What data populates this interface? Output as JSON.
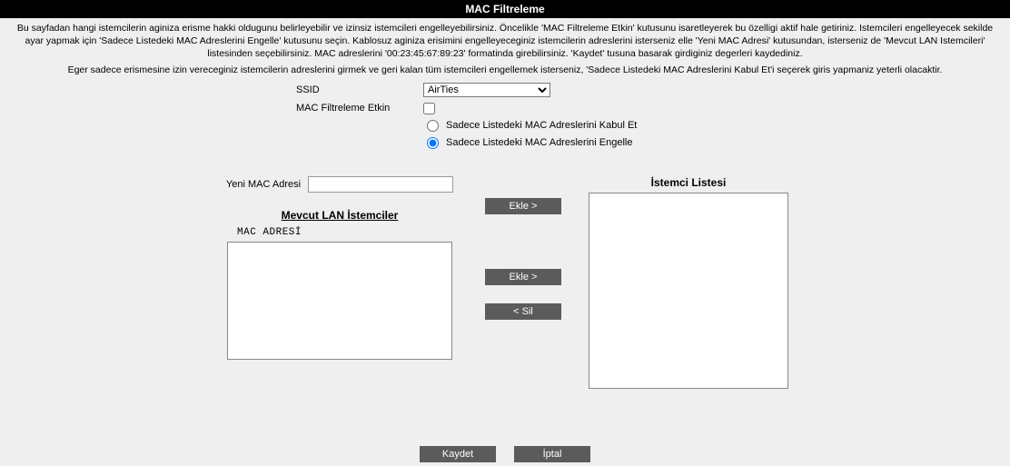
{
  "title": "MAC Filtreleme",
  "intro": "Bu sayfadan hangi istemcilerin aginiza erisme hakki oldugunu belirleyebilir ve izinsiz istemcileri engelleyebilirsiniz. Öncelikle 'MAC Filtreleme Etkin' kutusunu isaretleyerek bu özelligi aktif hale getiriniz. Istemcileri engelleyecek sekilde ayar yapmak için 'Sadece Listedeki MAC Adreslerini Engelle' kutusunu seçin. Kablosuz aginiza erisimini engelleyeceginiz istemcilerin adreslerini isterseniz elle 'Yeni MAC Adresi' kutusundan, isterseniz de 'Mevcut LAN Istemcileri' listesinden seçebilirsiniz. MAC adreslerini '00:23:45:67:89:23' formatinda girebilirsiniz. 'Kaydet' tusuna basarak girdiginiz degerleri kaydediniz.",
  "intro2": "Eger sadece erismesine izin vereceginiz istemcilerin adreslerini girmek ve geri kalan tüm istemcileri engellemek isterseniz, 'Sadece Listedeki MAC Adreslerini Kabul Et'i seçerek giris yapmaniz yeterli olacaktir.",
  "config": {
    "ssid_label": "SSID",
    "ssid_selected": "AirTies",
    "enable_label": "MAC Filtreleme Etkin",
    "enable_checked": false,
    "mode_accept_label": "Sadece Listedeki MAC Adreslerini Kabul Et",
    "mode_block_label": "Sadece Listedeki MAC Adreslerini Engelle",
    "mode_selected": "block"
  },
  "new_mac": {
    "label": "Yeni MAC Adresi",
    "value": ""
  },
  "lan_clients": {
    "header": "Mevcut LAN İstemciler",
    "column": "MAC ADRESİ",
    "items": []
  },
  "client_list": {
    "header": "İstemci Listesi",
    "items": []
  },
  "buttons": {
    "add_top": "Ekle >",
    "add_mid": "Ekle >",
    "remove": "< Sil",
    "save": "Kaydet",
    "cancel": "İptal"
  }
}
